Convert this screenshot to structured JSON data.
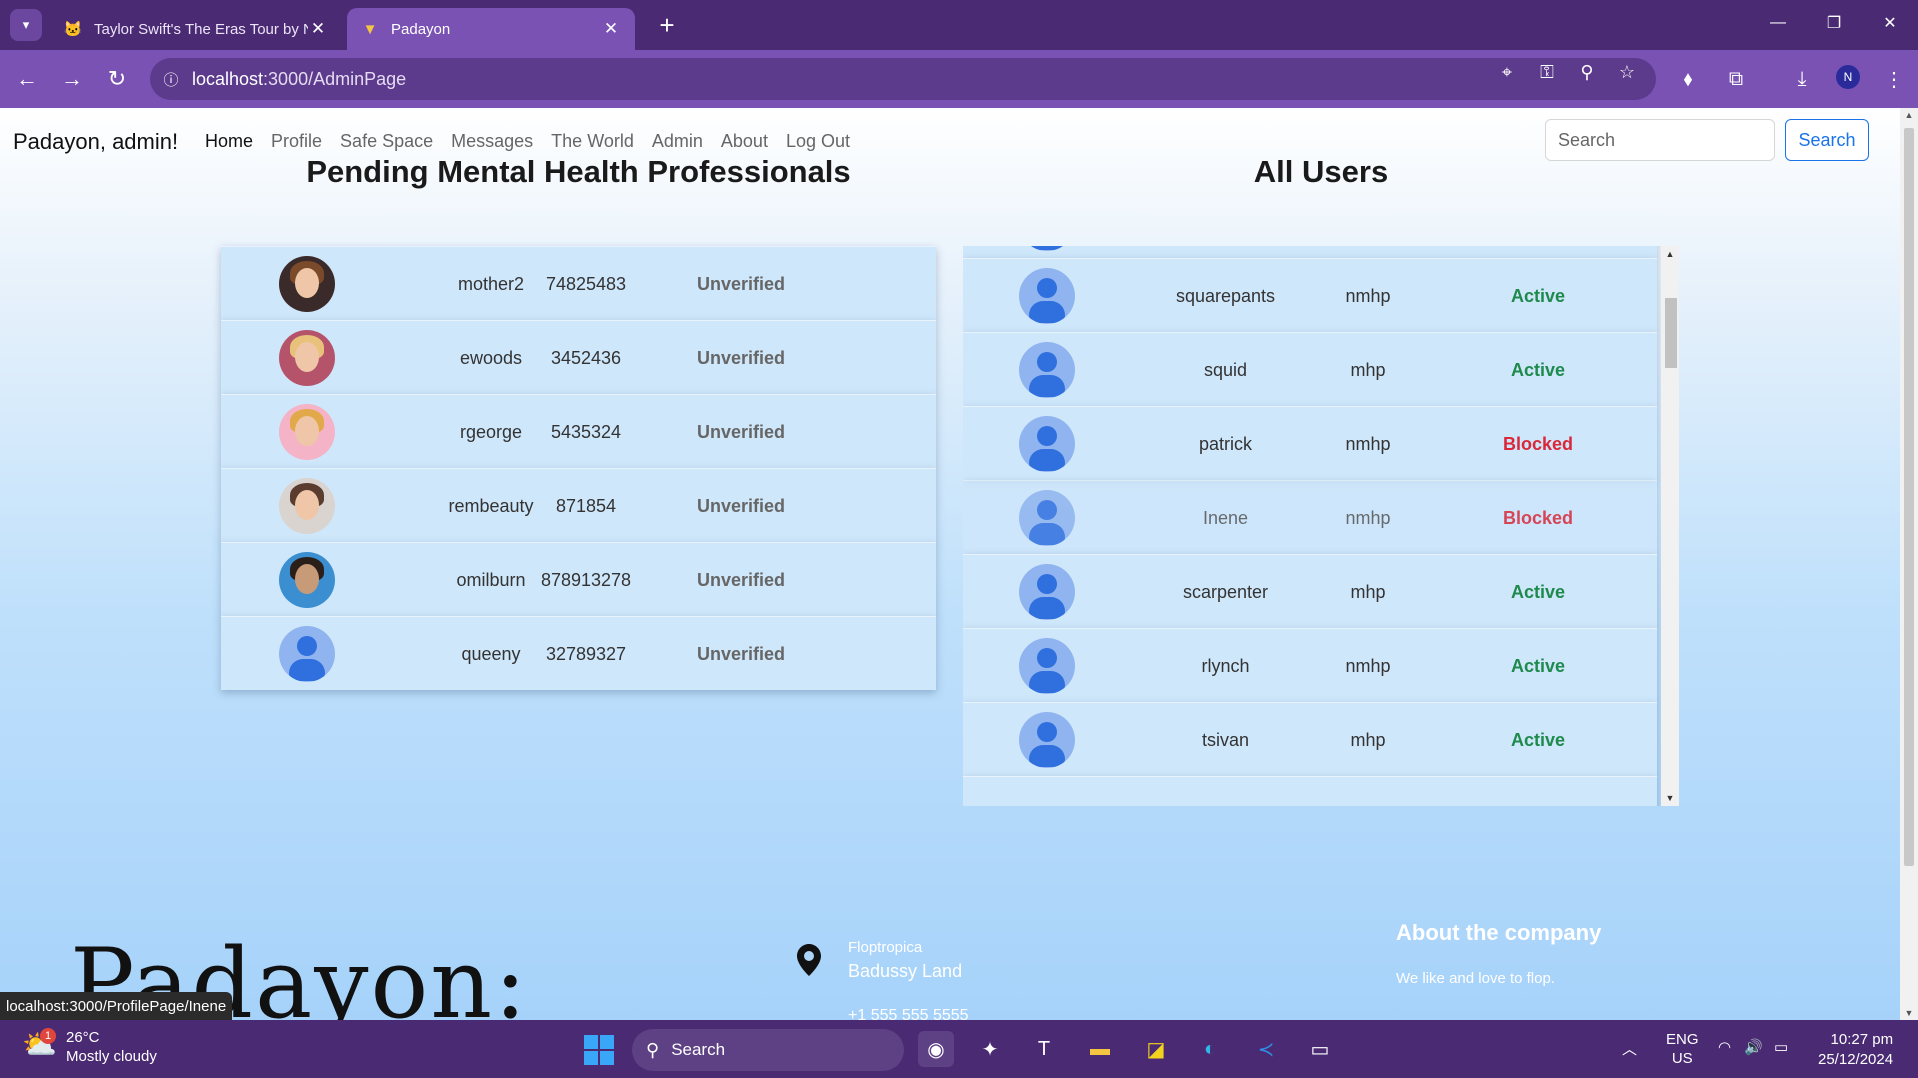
{
  "browser": {
    "tabs": [
      {
        "title": "Taylor Swift's The Eras Tour by N",
        "active": false
      },
      {
        "title": "Padayon",
        "active": true
      }
    ],
    "url_host": "localhost",
    "url_path": ":3000/AdminPage"
  },
  "navbar": {
    "brand": "Padayon, admin!",
    "links": [
      "Home",
      "Profile",
      "Safe Space",
      "Messages",
      "The World",
      "Admin",
      "About",
      "Log Out"
    ],
    "search_placeholder": "Search",
    "search_button": "Search"
  },
  "pending": {
    "title": "Pending Mental Health Professionals",
    "rows": [
      {
        "username": "mother2",
        "license": "74825483",
        "status": "Unverified",
        "avatar": "photo-1"
      },
      {
        "username": "ewoods",
        "license": "3452436",
        "status": "Unverified",
        "avatar": "photo-2"
      },
      {
        "username": "rgeorge",
        "license": "5435324",
        "status": "Unverified",
        "avatar": "photo-3"
      },
      {
        "username": "rembeauty",
        "license": "871854",
        "status": "Unverified",
        "avatar": "photo-4"
      },
      {
        "username": "omilburn",
        "license": "878913278",
        "status": "Unverified",
        "avatar": "photo-5"
      },
      {
        "username": "queeny",
        "license": "32789327",
        "status": "Unverified",
        "avatar": "default"
      }
    ]
  },
  "users": {
    "title": "All Users",
    "rows": [
      {
        "username": "squarepants",
        "role": "nmhp",
        "status": "Active"
      },
      {
        "username": "squid",
        "role": "mhp",
        "status": "Active"
      },
      {
        "username": "patrick",
        "role": "nmhp",
        "status": "Blocked"
      },
      {
        "username": "Inene",
        "role": "nmhp",
        "status": "Blocked"
      },
      {
        "username": "scarpenter",
        "role": "mhp",
        "status": "Active"
      },
      {
        "username": "rlynch",
        "role": "nmhp",
        "status": "Active"
      },
      {
        "username": "tsivan",
        "role": "mhp",
        "status": "Active"
      }
    ]
  },
  "footer": {
    "signature": "Padayon:",
    "address_line1": "Floptropica",
    "address_line2": "Badussy Land",
    "phone": "+1 555 555 5555",
    "about_title": "About the company",
    "about_text": "We like and love to flop."
  },
  "status_bar": {
    "hover_url": "localhost:3000/ProfilePage/Inene"
  },
  "taskbar": {
    "weather_temp": "26°C",
    "weather_desc": "Mostly cloudy",
    "weather_badge": "1",
    "search_label": "Search",
    "lang_top": "ENG",
    "lang_bottom": "US",
    "time": "10:27 pm",
    "date": "25/12/2024"
  },
  "colors": {
    "active": "#1e8a4c",
    "blocked": "#d9283a",
    "unverified": "#666666"
  }
}
